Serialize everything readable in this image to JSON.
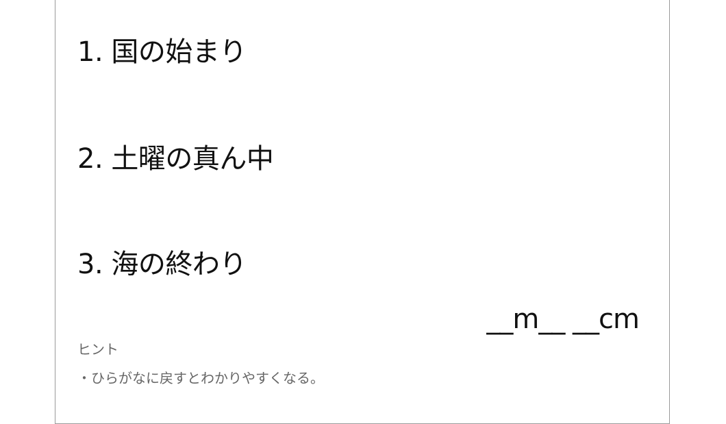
{
  "riddles": [
    {
      "number": "1.",
      "text": "国の始まり"
    },
    {
      "number": "2.",
      "text": "土曜の真ん中"
    },
    {
      "number": "3.",
      "text": "海の終わり"
    }
  ],
  "answer": {
    "text": "__m__ __cm"
  },
  "hint": {
    "title": "ヒント",
    "items": [
      "・ひらがなに戻すとわかりやすくなる。"
    ]
  }
}
